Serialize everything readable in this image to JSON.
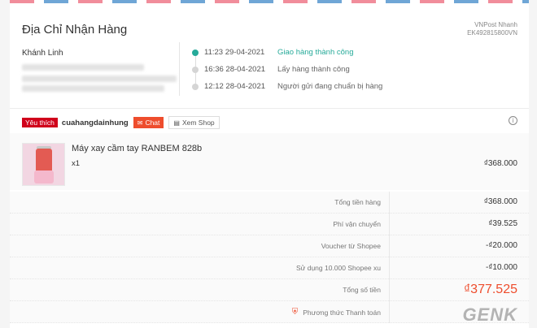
{
  "address": {
    "title": "Địa Chỉ Nhận Hàng",
    "recipient": "Khánh Linh"
  },
  "carrier": {
    "name": "VNPost Nhanh",
    "tracking": "EK492815800VN"
  },
  "timeline": [
    {
      "time": "11:23 29-04-2021",
      "status": "Giao hàng thành công"
    },
    {
      "time": "16:36 28-04-2021",
      "status": "Lấy hàng thành công"
    },
    {
      "time": "12:12 28-04-2021",
      "status": "Người gửi đang chuẩn bị hàng"
    }
  ],
  "shop": {
    "badge": "Yêu thích",
    "name": "cuahangdainhung",
    "chat_label": "Chat",
    "view_shop_label": "Xem Shop"
  },
  "product": {
    "name": "Máy xay cầm tay RANBEM 828b",
    "qty": "x1",
    "price": "₫368.000"
  },
  "summary": [
    {
      "label": "Tổng tiền hàng",
      "value": "₫368.000"
    },
    {
      "label": "Phí vận chuyển",
      "value": "₫39.525"
    },
    {
      "label": "Voucher từ Shopee",
      "value": "-₫20.000"
    },
    {
      "label": "Sử dụng 10.000 Shopee xu",
      "value": "-₫10.000"
    },
    {
      "label": "Tổng số tiền",
      "value": "₫377.525"
    },
    {
      "label": "Phương thức Thanh toán",
      "value": ""
    }
  ],
  "watermark": "GENK",
  "colors": {
    "accent": "#ee4d2d",
    "success": "#26aa99",
    "badge": "#d0011b"
  },
  "icons": {
    "info": "info-circle-icon",
    "chat": "chat-icon",
    "shop": "store-icon",
    "payment": "shield-icon"
  }
}
